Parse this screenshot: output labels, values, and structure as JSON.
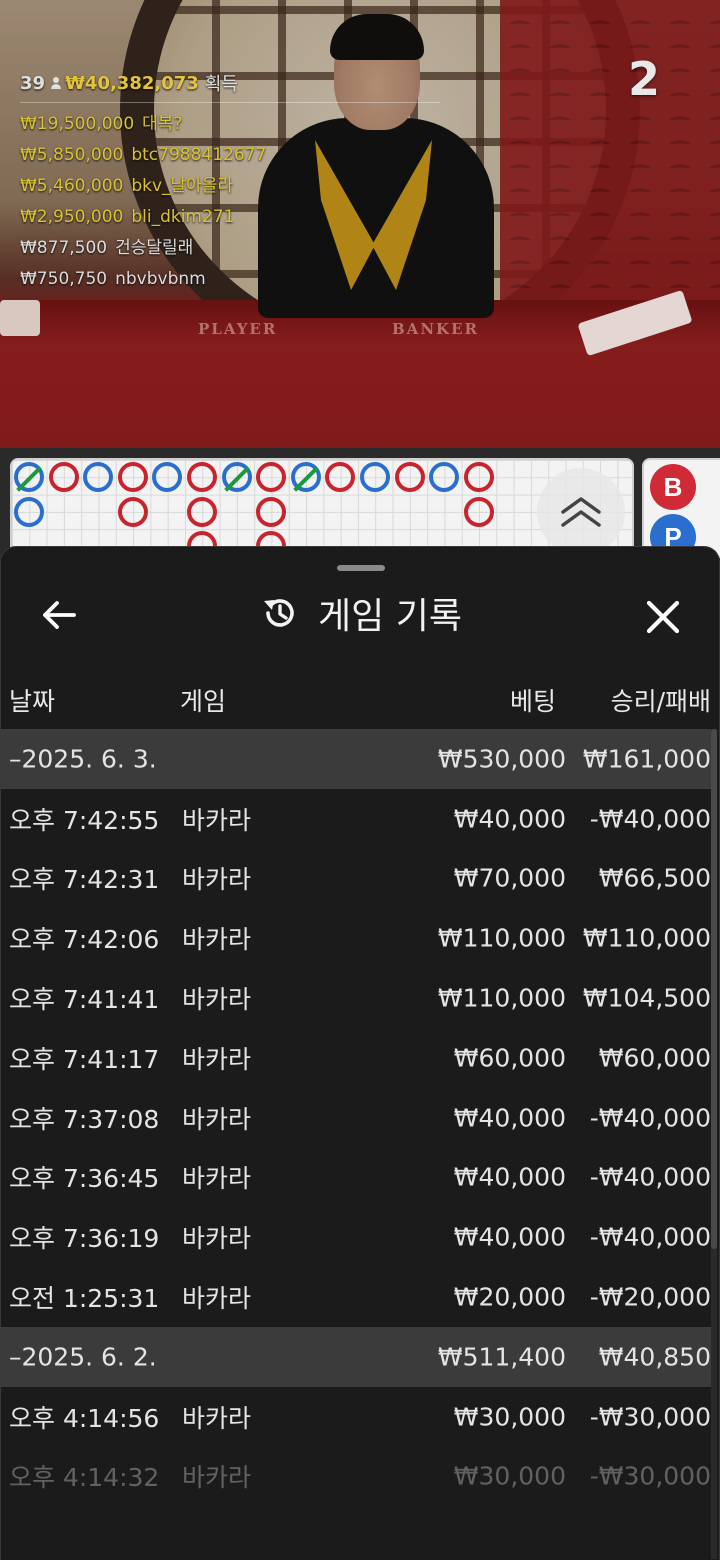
{
  "video": {
    "round_count": "2",
    "table_labels": {
      "player": "PLAYER",
      "banker": "BANKER"
    },
    "winners_header": {
      "count": "39",
      "total": "₩40,382,073",
      "suffix": "획득"
    },
    "winners": [
      {
        "amount": "₩19,500,000",
        "name": "대복?",
        "tone": "gold"
      },
      {
        "amount": "₩5,850,000",
        "name": "btc7988412677",
        "tone": "gold"
      },
      {
        "amount": "₩5,460,000",
        "name": "bkv_날아올라",
        "tone": "gold"
      },
      {
        "amount": "₩2,950,000",
        "name": "bli_dkim271",
        "tone": "gold"
      },
      {
        "amount": "₩877,500",
        "name": "건승달릴래",
        "tone": "white"
      },
      {
        "amount": "₩750,750",
        "name": "nbvbvbnm",
        "tone": "white"
      }
    ]
  },
  "bead_road": {
    "beads": [
      {
        "col": 0,
        "row": 0,
        "color": "blue",
        "tie": true
      },
      {
        "col": 0,
        "row": 1,
        "color": "blue",
        "tie": false
      },
      {
        "col": 1,
        "row": 0,
        "color": "red",
        "tie": false
      },
      {
        "col": 2,
        "row": 0,
        "color": "blue",
        "tie": false
      },
      {
        "col": 3,
        "row": 0,
        "color": "red",
        "tie": false
      },
      {
        "col": 3,
        "row": 1,
        "color": "red",
        "tie": false
      },
      {
        "col": 4,
        "row": 0,
        "color": "blue",
        "tie": false
      },
      {
        "col": 5,
        "row": 0,
        "color": "red",
        "tie": false
      },
      {
        "col": 5,
        "row": 1,
        "color": "red",
        "tie": false
      },
      {
        "col": 5,
        "row": 2,
        "color": "red",
        "tie": false
      },
      {
        "col": 6,
        "row": 0,
        "color": "blue",
        "tie": true
      },
      {
        "col": 7,
        "row": 0,
        "color": "red",
        "tie": false
      },
      {
        "col": 7,
        "row": 1,
        "color": "red",
        "tie": false
      },
      {
        "col": 7,
        "row": 2,
        "color": "red",
        "tie": false
      },
      {
        "col": 8,
        "row": 0,
        "color": "blue",
        "tie": true
      },
      {
        "col": 9,
        "row": 0,
        "color": "red",
        "tie": false
      },
      {
        "col": 10,
        "row": 0,
        "color": "blue",
        "tie": false
      },
      {
        "col": 11,
        "row": 0,
        "color": "red",
        "tie": false
      },
      {
        "col": 12,
        "row": 0,
        "color": "blue",
        "tie": false
      },
      {
        "col": 13,
        "row": 0,
        "color": "red",
        "tie": false
      },
      {
        "col": 13,
        "row": 1,
        "color": "red",
        "tie": false
      }
    ],
    "side_labels": {
      "banker": "B",
      "player": "P"
    }
  },
  "history": {
    "title": "게임 기록",
    "columns": {
      "date": "날짜",
      "game": "게임",
      "bet": "베팅",
      "result": "승리/패배"
    },
    "rows": [
      {
        "type": "group",
        "time": "–2025. 6. 3.",
        "game": "",
        "bet": "₩530,000",
        "result": "₩161,000"
      },
      {
        "type": "item",
        "time": "오후 7:42:55",
        "game": "바카라",
        "bet": "₩40,000",
        "result": "-₩40,000"
      },
      {
        "type": "item",
        "time": "오후 7:42:31",
        "game": "바카라",
        "bet": "₩70,000",
        "result": "₩66,500"
      },
      {
        "type": "item",
        "time": "오후 7:42:06",
        "game": "바카라",
        "bet": "₩110,000",
        "result": "₩110,000"
      },
      {
        "type": "item",
        "time": "오후 7:41:41",
        "game": "바카라",
        "bet": "₩110,000",
        "result": "₩104,500"
      },
      {
        "type": "item",
        "time": "오후 7:41:17",
        "game": "바카라",
        "bet": "₩60,000",
        "result": "₩60,000"
      },
      {
        "type": "item",
        "time": "오후 7:37:08",
        "game": "바카라",
        "bet": "₩40,000",
        "result": "-₩40,000"
      },
      {
        "type": "item",
        "time": "오후 7:36:45",
        "game": "바카라",
        "bet": "₩40,000",
        "result": "-₩40,000"
      },
      {
        "type": "item",
        "time": "오후 7:36:19",
        "game": "바카라",
        "bet": "₩40,000",
        "result": "-₩40,000"
      },
      {
        "type": "item",
        "time": "오전 1:25:31",
        "game": "바카라",
        "bet": "₩20,000",
        "result": "-₩20,000"
      },
      {
        "type": "group",
        "time": "–2025. 6. 2.",
        "game": "",
        "bet": "₩511,400",
        "result": "₩40,850"
      },
      {
        "type": "item",
        "time": "오후 4:14:56",
        "game": "바카라",
        "bet": "₩30,000",
        "result": "-₩30,000"
      },
      {
        "type": "item",
        "time": "오후 4:14:32",
        "game": "바카라",
        "bet": "₩30,000",
        "result": "-₩30,000",
        "faded": true
      }
    ]
  },
  "icons": {
    "back": "arrow-left-icon",
    "history": "history-clock-icon",
    "close": "close-icon",
    "collapse": "chevron-double-up-icon"
  }
}
